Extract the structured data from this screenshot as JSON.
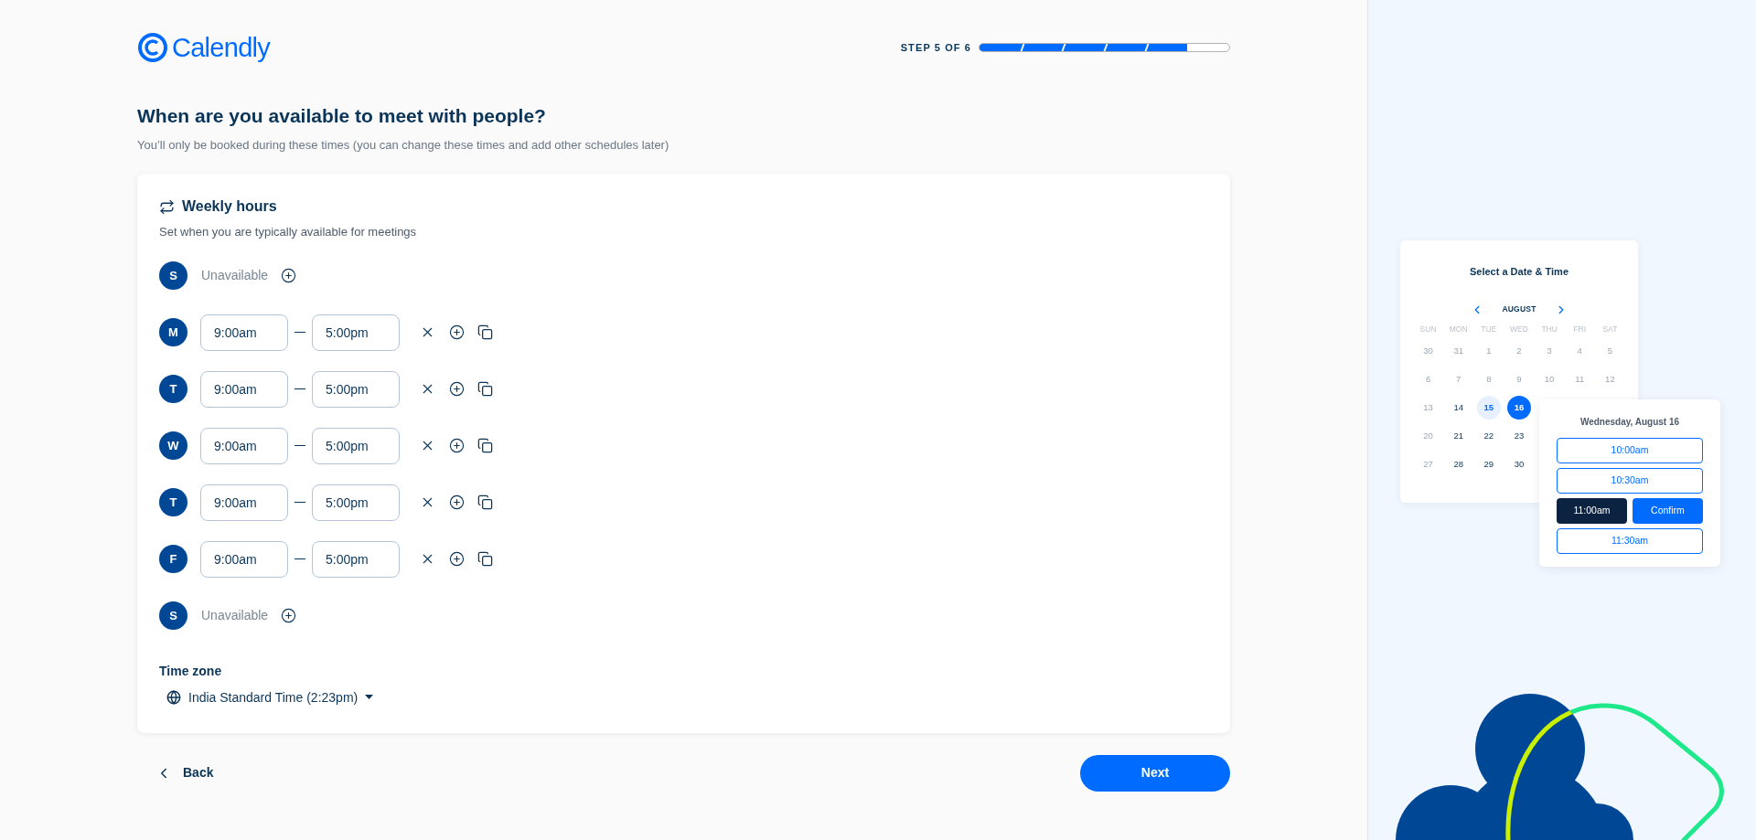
{
  "logo": {
    "text": "Calendly"
  },
  "progress": {
    "label": "STEP 5 OF 6",
    "level": 0.833
  },
  "heading": "When are you available to meet with people?",
  "subheading": "You’ll only be booked during these times (you can change these times and add other schedules later)",
  "card": {
    "title": "Weekly hours",
    "subtitle": "Set when you are typically available for meetings",
    "days": [
      {
        "letter": "S",
        "kind": "unavailable",
        "text": "Unavailable"
      },
      {
        "letter": "M",
        "kind": "hours",
        "start": "9:00am",
        "end": "5:00pm"
      },
      {
        "letter": "T",
        "kind": "hours",
        "start": "9:00am",
        "end": "5:00pm"
      },
      {
        "letter": "W",
        "kind": "hours",
        "start": "9:00am",
        "end": "5:00pm"
      },
      {
        "letter": "T",
        "kind": "hours",
        "start": "9:00am",
        "end": "5:00pm"
      },
      {
        "letter": "F",
        "kind": "hours",
        "start": "9:00am",
        "end": "5:00pm"
      },
      {
        "letter": "S",
        "kind": "unavailable",
        "text": "Unavailable"
      }
    ],
    "timezone": {
      "label": "Time zone",
      "value": "India Standard Time (2:23pm)"
    }
  },
  "back": "Back",
  "next": "Next",
  "preview": {
    "title": "Select a Date & Time",
    "month": "AUGUST",
    "weekdays": [
      "SUN",
      "MON",
      "TUE",
      "WED",
      "THU",
      "FRI",
      "SAT"
    ],
    "weeks": [
      [
        {
          "day": "30",
          "kind": "muted"
        },
        {
          "day": "31",
          "kind": "muted"
        },
        {
          "day": "1",
          "kind": "muted"
        },
        {
          "day": "2",
          "kind": "muted"
        },
        {
          "day": "3",
          "kind": "muted"
        },
        {
          "day": "4",
          "kind": "muted"
        },
        {
          "day": "5",
          "kind": "muted"
        }
      ],
      [
        {
          "day": "6",
          "kind": "muted"
        },
        {
          "day": "7",
          "kind": "muted"
        },
        {
          "day": "8",
          "kind": "muted"
        },
        {
          "day": "9",
          "kind": "muted"
        },
        {
          "day": "10",
          "kind": "muted"
        },
        {
          "day": "11",
          "kind": "muted"
        },
        {
          "day": "12",
          "kind": "muted"
        }
      ],
      [
        {
          "day": "13",
          "kind": "muted"
        },
        {
          "day": "14",
          "kind": "normal"
        },
        {
          "day": "15",
          "kind": "available"
        },
        {
          "day": "16",
          "kind": "selected"
        }
      ],
      [
        {
          "day": "20",
          "kind": "muted"
        },
        {
          "day": "21",
          "kind": "normal"
        },
        {
          "day": "22",
          "kind": "normal"
        },
        {
          "day": "23",
          "kind": "normal"
        }
      ],
      [
        {
          "day": "27",
          "kind": "muted"
        },
        {
          "day": "28",
          "kind": "normal"
        },
        {
          "day": "29",
          "kind": "normal"
        },
        {
          "day": "30",
          "kind": "normal"
        }
      ]
    ],
    "times": {
      "date": "Wednesday, August 16",
      "confirm": "Confirm",
      "slots": [
        {
          "label": "10:00am",
          "selected": false
        },
        {
          "label": "10:30am",
          "selected": false
        },
        {
          "label": "11:00am",
          "selected": true
        },
        {
          "label": "11:30am",
          "selected": false
        }
      ]
    }
  }
}
